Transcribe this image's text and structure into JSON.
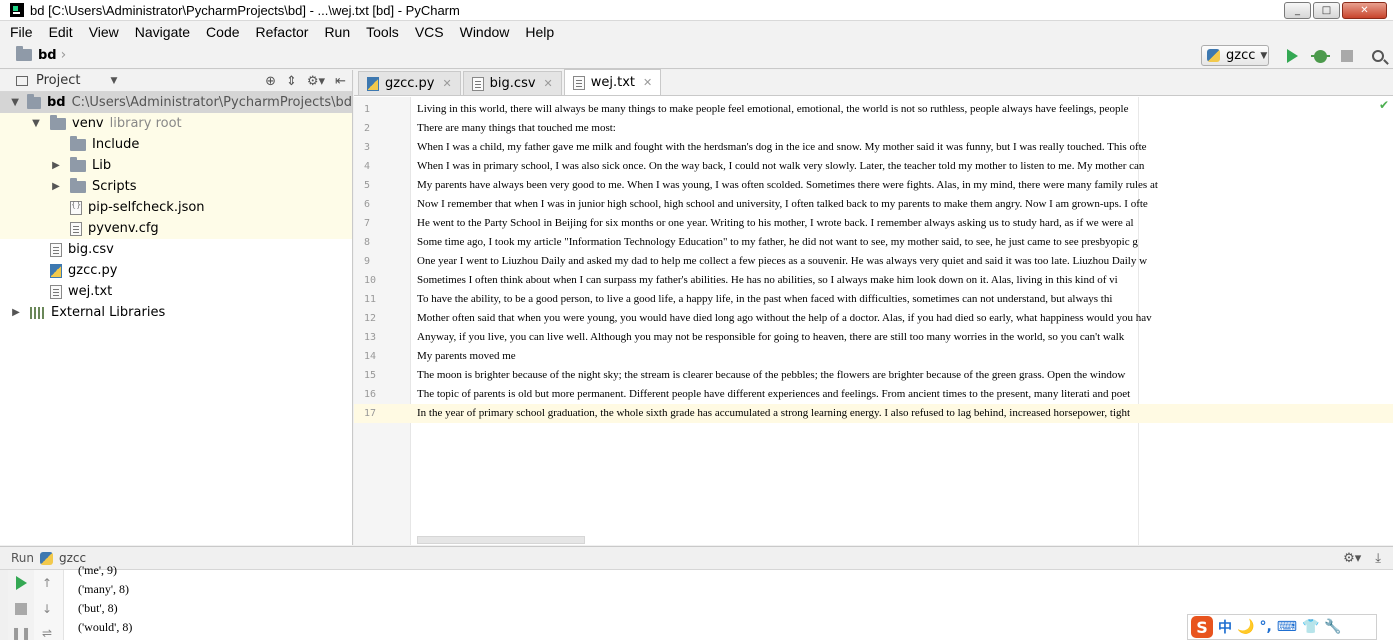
{
  "window": {
    "title": "bd [C:\\Users\\Administrator\\PycharmProjects\\bd] - ...\\wej.txt [bd] - PyCharm",
    "controls": [
      "_",
      "□",
      "✕"
    ]
  },
  "menu": [
    "File",
    "Edit",
    "View",
    "Navigate",
    "Code",
    "Refactor",
    "Run",
    "Tools",
    "VCS",
    "Window",
    "Help"
  ],
  "navbar": {
    "breadcrumb": "bd",
    "run_config": "gzcc"
  },
  "project_panel": {
    "title": "Project",
    "tree": [
      {
        "label": "bd",
        "path": "C:\\Users\\Administrator\\PycharmProjects\\bd",
        "expander": "▼",
        "icon": "folder-icon",
        "indent": 0,
        "bold": true,
        "selected": true
      },
      {
        "label": "venv",
        "muted": "library root",
        "expander": "▼",
        "icon": "folder-icon",
        "indent": 1
      },
      {
        "label": "Include",
        "expander": "",
        "icon": "folder-icon",
        "indent": 2
      },
      {
        "label": "Lib",
        "expander": "▶",
        "icon": "folder-icon",
        "indent": 2
      },
      {
        "label": "Scripts",
        "expander": "▶",
        "icon": "folder-icon",
        "indent": 2
      },
      {
        "label": "pip-selfcheck.json",
        "expander": "",
        "icon": "json-file-icon",
        "indent": 2
      },
      {
        "label": "pyvenv.cfg",
        "expander": "",
        "icon": "cfg-file-icon",
        "indent": 2
      },
      {
        "label": "big.csv",
        "expander": "",
        "icon": "csv-file-icon",
        "indent": 1
      },
      {
        "label": "gzcc.py",
        "expander": "",
        "icon": "python-file-icon",
        "indent": 1
      },
      {
        "label": "wej.txt",
        "expander": "",
        "icon": "text-file-icon",
        "indent": 1
      },
      {
        "label": "External Libraries",
        "expander": "▶",
        "icon": "library-icon",
        "indent": 0
      }
    ]
  },
  "editor": {
    "tabs": [
      {
        "label": "gzcc.py",
        "active": false
      },
      {
        "label": "big.csv",
        "active": false
      },
      {
        "label": "wej.txt",
        "active": true
      }
    ],
    "current_line": 17,
    "lines": [
      "Living in this world, there will always be many things to make people feel emotional, emotional, the world is not so ruthless, people always have feelings, people",
      "There are many things that touched me most:",
      "When I was a child, my father gave me milk and fought with the herdsman's dog in the ice and snow. My mother said it was funny, but I was really touched. This ofte",
      "When I was in primary school, I was also sick once. On the way back, I could not walk very slowly. Later, the teacher told my mother to listen to me. My mother can",
      "My parents have always been very good to me. When I was young, I was often scolded. Sometimes there were fights. Alas, in my mind, there were many family rules at",
      "Now I remember that when I was in junior high school, high school and university, I often talked back to my parents to make them angry. Now I am grown-ups. I ofte",
      "He went to the Party School in Beijing for six months or one year. Writing to his mother, I wrote back. I remember always asking us to study hard, as if we were al",
      "Some time ago, I took my article \"Information Technology Education\" to my father, he did not want to see, my mother said, to see, he just came to see presbyopic g",
      "One year I went to Liuzhou Daily and asked my dad to help me collect a few pieces as a souvenir. He was always very quiet and said it was too late. Liuzhou Daily w",
      "Sometimes I often think about when I can surpass my father's abilities. He has no abilities, so I always make him look down on it. Alas, living in this kind of vi",
      "To have the ability, to be a good person, to live a good life, a happy life, in the past when faced with difficulties, sometimes can not understand, but always thi",
      "Mother often said that when you were young, you would have died long ago without the help of a doctor. Alas, if you had died so early, what happiness would you hav",
      "Anyway, if you live, you can live well. Although you may not be responsible for going to heaven, there are still too many worries in the world, so you can't walk",
      "My parents moved me",
      "The moon is brighter because of the night sky; the stream is clearer because of the pebbles; the flowers are brighter because of the green grass. Open the window",
      "The topic of parents is old but more permanent. Different people have different experiences and feelings. From ancient times to the present, many literati and poet",
      "In the year of primary school graduation, the whole sixth grade has accumulated a strong learning energy. I also refused to lag behind, increased horsepower, tight"
    ]
  },
  "run_window": {
    "label": "Run",
    "config": "gzcc",
    "output": [
      "('me', 9)",
      "('many', 8)",
      "('but', 8)",
      "('would', 8)"
    ]
  },
  "ime": {
    "logo": "S",
    "items": [
      "中",
      "🌙",
      "°,",
      "⌨",
      "👕",
      "🔧"
    ]
  }
}
